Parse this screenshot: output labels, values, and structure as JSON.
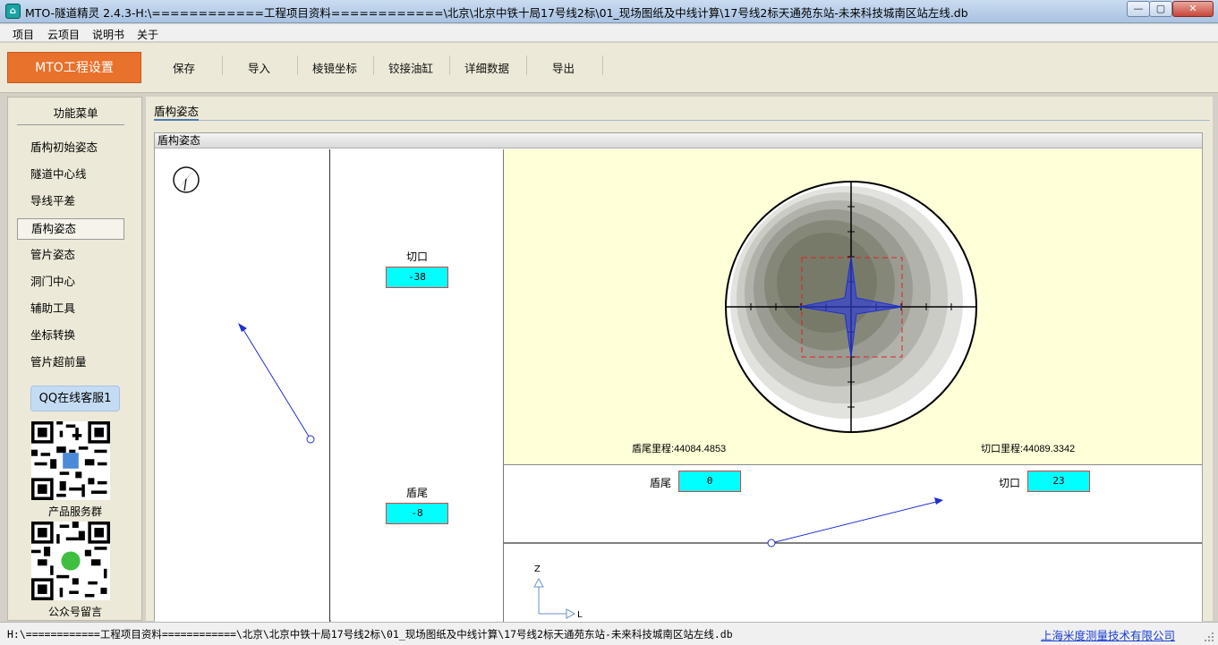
{
  "window": {
    "title": "MTO-隧道精灵 2.4.3-H:\\============工程项目资料============\\北京\\北京中铁十局17号线2标\\01_现场图纸及中线计算\\17号线2标天通苑东站-未来科技城南区站左线.db",
    "min_label": "—",
    "max_label": "▢",
    "close_label": "✕"
  },
  "menu": {
    "items": [
      "项目",
      "云项目",
      "说明书",
      "关于"
    ]
  },
  "toolbar": {
    "settings_label": "MTO工程设置",
    "buttons": [
      "保存",
      "导入",
      "棱镜坐标",
      "铰接油缸",
      "详细数据",
      "导出"
    ]
  },
  "sidebar": {
    "title": "功能菜单",
    "items": [
      "盾构初始姿态",
      "隧道中心线",
      "导线平差",
      "盾构姿态",
      "管片姿态",
      "洞门中心",
      "辅助工具",
      "坐标转换",
      "管片超前量"
    ],
    "active_index": 3,
    "qq_label": "QQ在线客服1",
    "qr1_label": "产品服务群",
    "qr2_label": "公众号留言"
  },
  "main": {
    "tab_label": "盾构姿态",
    "group_title": "盾构姿态",
    "left_pane": {
      "cut_label": "切口",
      "cut_value": "-38",
      "tail_label": "盾尾",
      "tail_value": "-8"
    },
    "target": {
      "tail_mileage_label": "盾尾里程:",
      "tail_mileage": "44084.4853",
      "cut_mileage_label": "切口里程:",
      "cut_mileage": "44089.3342"
    },
    "bottom_pane": {
      "tail_label": "盾尾",
      "tail_value": "0",
      "cut_label": "切口",
      "cut_value": "23",
      "z_axis": "Z",
      "l_axis": "L"
    }
  },
  "statusbar": {
    "path": "H:\\============工程项目资料============\\北京\\北京中铁十局17号线2标\\01_现场图纸及中线计算\\17号线2标天通苑东站-未来科技城南区站左线.db",
    "company": "上海米度测量技术有限公司"
  },
  "colors": {
    "accent_orange": "#e8712c",
    "value_box": "#00ffff",
    "vector_blue": "#1f2fd0",
    "target_bg": "#ffffd8"
  }
}
